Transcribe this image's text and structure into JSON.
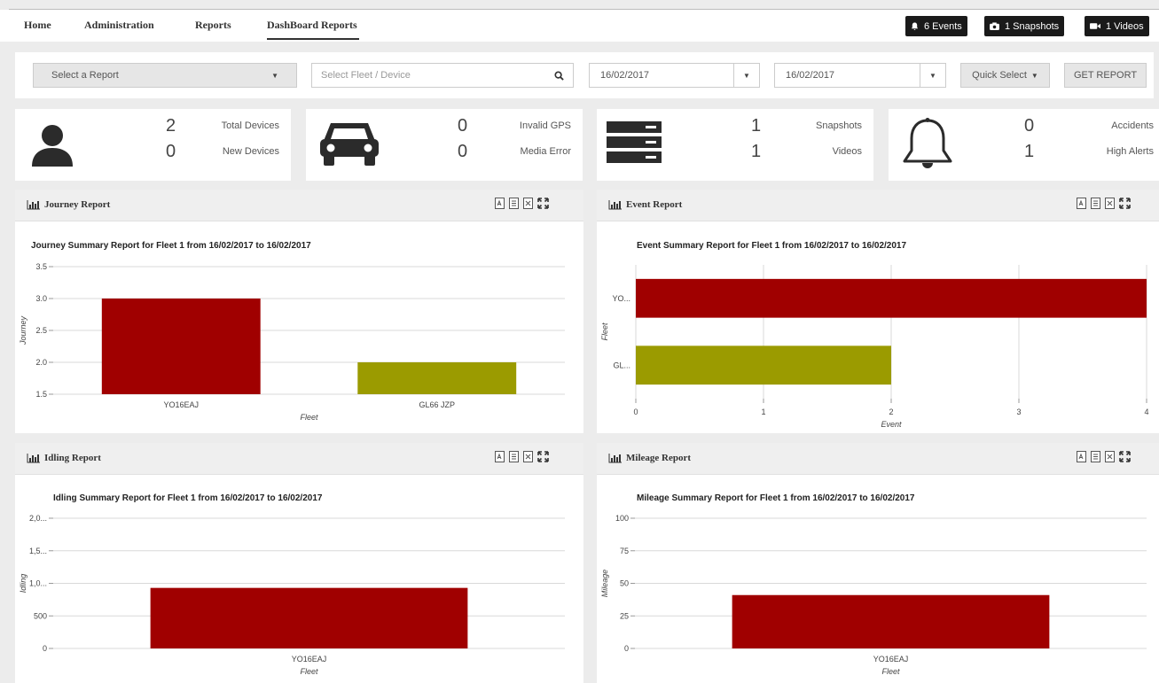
{
  "nav": {
    "items": [
      "Home",
      "Administration",
      "Reports",
      "DashBoard Reports"
    ],
    "events_btn": "6 Events",
    "snapshots_btn": "1 Snapshots",
    "videos_btn": "1 Videos"
  },
  "filters": {
    "report_select": "Select a Report",
    "fleet_placeholder": "Select Fleet / Device",
    "date_from": "16/02/2017",
    "date_to": "16/02/2017",
    "quick_select": "Quick Select",
    "get_report": "GET REPORT"
  },
  "stats": [
    {
      "icon": "user-icon",
      "rows": [
        {
          "value": "2",
          "label": "Total Devices"
        },
        {
          "value": "0",
          "label": "New Devices"
        }
      ]
    },
    {
      "icon": "car-icon",
      "rows": [
        {
          "value": "0",
          "label": "Invalid GPS"
        },
        {
          "value": "0",
          "label": "Media Error"
        }
      ]
    },
    {
      "icon": "server-icon",
      "rows": [
        {
          "value": "1",
          "label": "Snapshots"
        },
        {
          "value": "1",
          "label": "Videos"
        }
      ]
    },
    {
      "icon": "bell-icon",
      "rows": [
        {
          "value": "0",
          "label": "Accidents"
        },
        {
          "value": "1",
          "label": "High Alerts"
        }
      ]
    }
  ],
  "panels": {
    "journey": {
      "title": "Journey Report"
    },
    "event": {
      "title": "Event Report"
    },
    "idling": {
      "title": "Idling Report"
    },
    "mileage": {
      "title": "Mileage Report"
    }
  },
  "colors": {
    "red": "#a00000",
    "olive": "#9b9b00"
  },
  "chart_data": [
    {
      "type": "bar",
      "title": "Journey Summary Report for Fleet 1 from 16/02/2017 to 16/02/2017",
      "categories": [
        "YO16EAJ",
        "GL66 JZP"
      ],
      "values": [
        3.0,
        2.0
      ],
      "colors": [
        "#a00000",
        "#9b9b00"
      ],
      "xlabel": "Fleet",
      "ylabel": "Journey",
      "ylim": [
        1.5,
        3.5
      ],
      "yticks": [
        "3.5",
        "3.0",
        "2.5",
        "2.0",
        "1.5"
      ],
      "grid": true
    },
    {
      "type": "bar",
      "orientation": "horizontal",
      "title": "Event Summary Report for Fleet 1 from 16/02/2017 to 16/02/2017",
      "categories": [
        "YO...",
        "GL..."
      ],
      "values": [
        4,
        2
      ],
      "colors": [
        "#a00000",
        "#9b9b00"
      ],
      "xlabel": "Event",
      "ylabel": "Fleet",
      "xlim": [
        0,
        4
      ],
      "xticks": [
        "0",
        "1",
        "2",
        "3",
        "4"
      ],
      "grid": true
    },
    {
      "type": "bar",
      "title": "Idling Summary Report for Fleet 1 from 16/02/2017 to 16/02/2017",
      "categories": [
        "YO16EAJ"
      ],
      "values": [
        930
      ],
      "colors": [
        "#a00000"
      ],
      "xlabel": "Fleet",
      "ylabel": "Idling",
      "ylim": [
        0,
        2000
      ],
      "yticks": [
        "2,0...",
        "1,5...",
        "1,0...",
        "500",
        "0"
      ],
      "grid": true
    },
    {
      "type": "bar",
      "title": "Mileage Summary Report for Fleet 1 from 16/02/2017 to 16/02/2017",
      "categories": [
        "YO16EAJ"
      ],
      "values": [
        41
      ],
      "colors": [
        "#a00000"
      ],
      "xlabel": "Fleet",
      "ylabel": "Mileage",
      "ylim": [
        0,
        100
      ],
      "yticks": [
        "100",
        "75",
        "50",
        "25",
        "0"
      ],
      "grid": true
    }
  ]
}
